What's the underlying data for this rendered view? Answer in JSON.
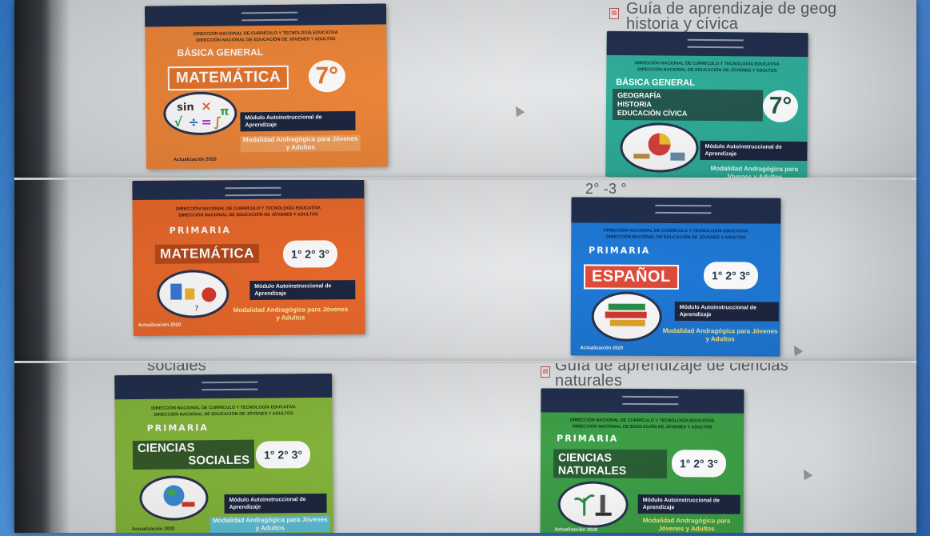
{
  "captions": {
    "top_right": "Guía de aprendizaje de geog\nhistoria y cívica",
    "mid_right": "2° -3 °",
    "bottom_left": "sociales",
    "bottom_right": "Guía de aprendizaje de ciencias\nnaturales"
  },
  "covers": [
    {
      "id": "matematica-7",
      "inst_line1": "DIRECCIÓN NACIONAL DE CURRÍCULO Y TECNOLOGÍA EDUCATIVA",
      "inst_line2": "DIRECCIÓN NACIONAL DE EDUCACIÓN DE JÓVENES Y ADULTOS",
      "level": "BÁSICA GENERAL",
      "title": "MATEMÁTICA",
      "grade": "7°",
      "module": "Módulo Autoinstruccional de Aprendizaje",
      "modality": "Modalidad Andragógica para Jóvenes y Adultos",
      "update": "Actualización 2020",
      "color": "#f0873a"
    },
    {
      "id": "geografia-7",
      "inst_line1": "DIRECCIÓN NACIONAL DE CURRÍCULO Y TECNOLOGÍA EDUCATIVA",
      "inst_line2": "DIRECCIÓN NACIONAL DE EDUCACIÓN DE JÓVENES Y ADULTOS",
      "level": "BÁSICA GENERAL",
      "subjects": [
        "GEOGRAFÍA",
        "HISTORIA",
        "EDUCACIÓN CÍVICA"
      ],
      "grade": "7°",
      "module": "Módulo Autoinstruccional de Aprendizaje",
      "modality": "Modalidad Andragógica para Jóvenes y Adultos",
      "color": "#2fae9a"
    },
    {
      "id": "matematica-primaria",
      "inst_line1": "DIRECCIÓN NACIONAL DE CURRÍCULO Y TECNOLOGÍA EDUCATIVA",
      "inst_line2": "DIRECCIÓN NACIONAL DE EDUCACIÓN DE JÓVENES Y ADULTOS",
      "primaria": "PRIMARIA",
      "title": "MATEMÁTICA",
      "grades": "1° 2° 3°",
      "module": "Módulo Autoinstruccional de Aprendizaje",
      "modality": "Modalidad Andragógica para Jóvenes y Adultos",
      "update": "Actualización 2020",
      "color": "#ec6a2c"
    },
    {
      "id": "espanol-primaria",
      "inst_line1": "DIRECCIÓN NACIONAL DE CURRÍCULO Y TECNOLOGÍA EDUCATIVA",
      "inst_line2": "DIRECCIÓN NACIONAL DE EDUCACIÓN DE JÓVENES Y ADULTOS",
      "primaria": "PRIMARIA",
      "title": "ESPAÑOL",
      "grades": "1° 2° 3°",
      "module": "Módulo Autoinstruccional de Aprendizaje",
      "modality": "Modalidad Andragógica para Jóvenes y Adultos",
      "update": "Actualización 2020",
      "color": "#1f7ad8"
    },
    {
      "id": "sociales-primaria",
      "inst_line1": "DIRECCIÓN NACIONAL DE CURRÍCULO Y TECNOLOGÍA EDUCATIVA",
      "inst_line2": "DIRECCIÓN NACIONAL DE EDUCACIÓN DE JÓVENES Y ADULTOS",
      "primaria": "PRIMARIA",
      "title_line1": "CIENCIAS",
      "title_line2": "SOCIALES",
      "grades": "1° 2° 3°",
      "module": "Módulo Autoinstruccional de Aprendizaje",
      "modality": "Modalidad Andragógica para Jóvenes y Adultos",
      "update": "Actualización 2020",
      "color": "#86b83c"
    },
    {
      "id": "naturales-primaria",
      "inst_line1": "DIRECCIÓN NACIONAL DE CURRÍCULO Y TECNOLOGÍA EDUCATIVA",
      "inst_line2": "DIRECCIÓN NACIONAL DE EDUCACIÓN DE JÓVENES Y ADULTOS",
      "primaria": "PRIMARIA",
      "title_line1": "CIENCIAS",
      "title_line2": "NATURALES",
      "grades": "1° 2° 3°",
      "module": "Módulo Autoinstruccional de Aprendizaje",
      "modality": "Modalidad Andragógica para Jóvenes y Adultos",
      "update": "Actualización 2020",
      "color": "#3ea048"
    }
  ]
}
